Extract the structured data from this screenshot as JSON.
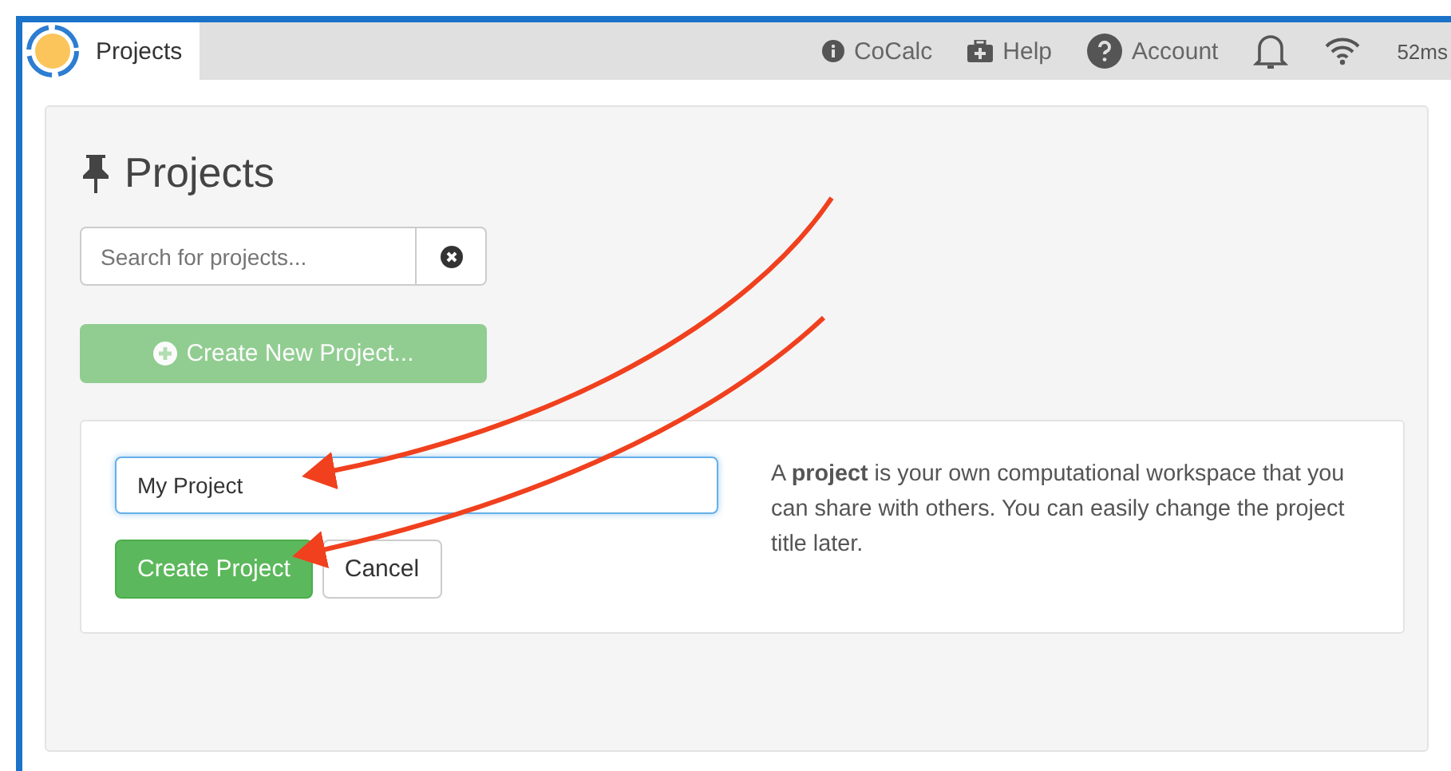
{
  "tab": {
    "label": "Projects",
    "selected": true
  },
  "nav": [
    {
      "kind": "info",
      "label": "CoCalc"
    },
    {
      "kind": "help",
      "label": "Help"
    },
    {
      "kind": "account",
      "label": "Account"
    }
  ],
  "ping": "52ms",
  "page": {
    "title": "Projects",
    "search": {
      "placeholder": "Search for projects..."
    },
    "create_button": {
      "label": "Create New Project...",
      "disabled": true
    },
    "form": {
      "title_value": "My Project",
      "create": "Create Project",
      "cancel": "Cancel",
      "description": "A **project** is your own computational workspace that you can share with others. You can easily change the project title later."
    }
  }
}
